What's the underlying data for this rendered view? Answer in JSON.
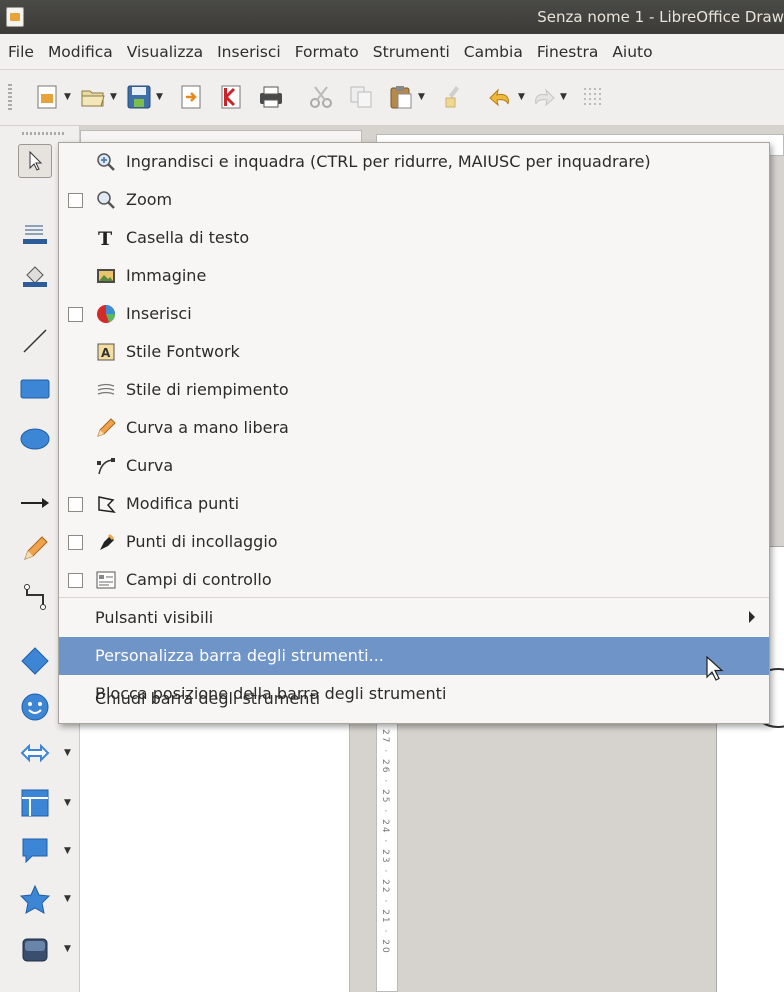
{
  "window": {
    "title": "Senza nome 1 - LibreOffice Draw"
  },
  "menubar": [
    "File",
    "Modifica",
    "Visualizza",
    "Inserisci",
    "Formato",
    "Strumenti",
    "Cambia",
    "Finestra",
    "Aiuto"
  ],
  "toolbar": {
    "icons": [
      "new-document",
      "open",
      "save",
      "export",
      "export-pdf",
      "print",
      "cut",
      "copy",
      "paste",
      "clone-formatting",
      "undo",
      "redo",
      "grid"
    ]
  },
  "left_toolbar": {
    "icons": [
      "select",
      "line-color",
      "area-fill",
      "line",
      "rectangle",
      "ellipse",
      "line-ends-arrow",
      "freeform-curve",
      "connector",
      "basic-shapes",
      "symbol-shapes",
      "block-arrows",
      "flowchart",
      "callouts",
      "stars",
      "3d-objects"
    ]
  },
  "ruler": {
    "vertical_numbers": "27 · 26 · 25 · 24 · 23 · 22 · 21 · 20"
  },
  "context_menu": {
    "items": [
      {
        "label": "Ingrandisci e inquadra (CTRL per ridurre, MAIUSC per inquadrare)",
        "checkbox": false,
        "icon": "zoom-pan-icon"
      },
      {
        "label": "Zoom",
        "checkbox": true,
        "icon": "zoom-icon"
      },
      {
        "label": "Casella di testo",
        "checkbox": false,
        "icon": "text-icon"
      },
      {
        "label": "Immagine",
        "checkbox": false,
        "icon": "image-icon"
      },
      {
        "label": "Inserisci",
        "checkbox": true,
        "icon": "insert-icon"
      },
      {
        "label": "Stile Fontwork",
        "checkbox": false,
        "icon": "fontwork-icon"
      },
      {
        "label": "Stile di riempimento",
        "checkbox": false,
        "icon": "fill-style-icon"
      },
      {
        "label": "Curva a mano libera",
        "checkbox": false,
        "icon": "pencil-icon"
      },
      {
        "label": "Curva",
        "checkbox": false,
        "icon": "curve-icon"
      },
      {
        "label": "Modifica punti",
        "checkbox": true,
        "icon": "edit-points-icon"
      },
      {
        "label": "Punti di incollaggio",
        "checkbox": true,
        "icon": "glue-points-icon"
      },
      {
        "label": "Campi di controllo",
        "checkbox": true,
        "icon": "form-controls-icon"
      }
    ],
    "visible_buttons": "Pulsanti visibili",
    "customize": "Personalizza barra degli strumenti...",
    "lock": "Blocca posizione della barra degli strumenti",
    "close": "Chiudi barra degli strumenti",
    "highlight_color": "#6f94c8"
  }
}
